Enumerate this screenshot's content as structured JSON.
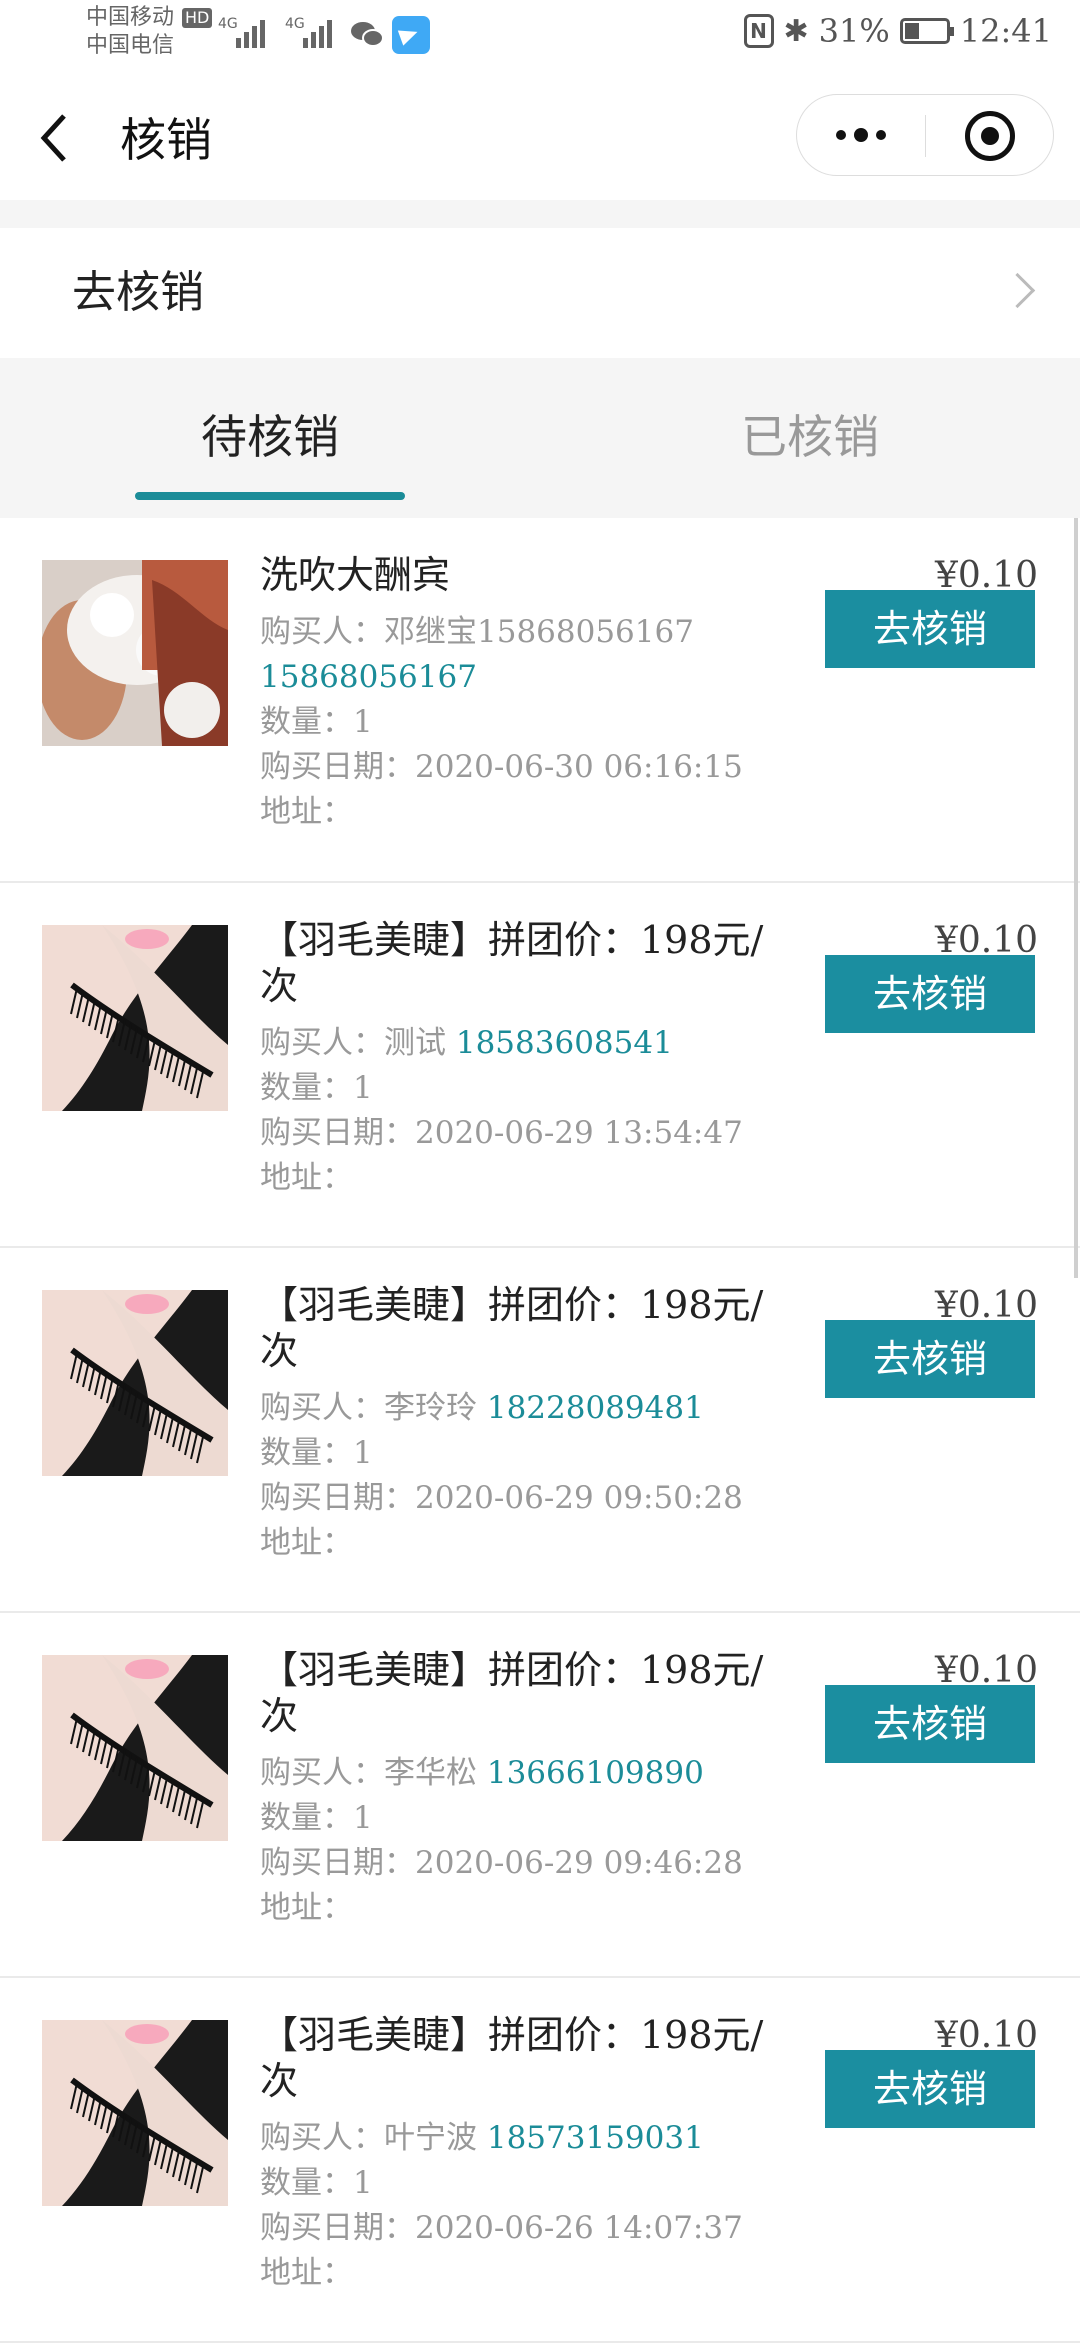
{
  "status_bar": {
    "carrier1": "中国移动",
    "carrier1_badge": "HD",
    "carrier2": "中国电信",
    "sig1": "4G",
    "sig2": "4G",
    "nfc": "N",
    "battery": "31%",
    "time": "12:41"
  },
  "nav": {
    "title": "核销"
  },
  "goto": {
    "label": "去核销"
  },
  "tabs": {
    "pending": "待核销",
    "done": "已核销",
    "active": "pending"
  },
  "labels": {
    "buyer": "购买人：",
    "qty": "数量：",
    "date": "购买日期：",
    "address": "地址：",
    "verify_button": "去核销"
  },
  "orders": [
    {
      "title": "洗吹大酬宾",
      "price": "¥0.10",
      "buyer": "邓继宝15868056167",
      "phone": "15868056167",
      "qty": "1",
      "date": "2020-06-30 06:16:15",
      "address": "",
      "image": "hair-wash"
    },
    {
      "title": "【羽毛美睫】拼团价：198元/次",
      "price": "¥0.10",
      "buyer": "测试",
      "phone": "18583608541",
      "qty": "1",
      "date": "2020-06-29 13:54:47",
      "address": "",
      "image": "eyelash"
    },
    {
      "title": "【羽毛美睫】拼团价：198元/次",
      "price": "¥0.10",
      "buyer": "李玲玲",
      "phone": "18228089481",
      "qty": "1",
      "date": "2020-06-29 09:50:28",
      "address": "",
      "image": "eyelash"
    },
    {
      "title": "【羽毛美睫】拼团价：198元/次",
      "price": "¥0.10",
      "buyer": "李华松",
      "phone": "13666109890",
      "qty": "1",
      "date": "2020-06-29 09:46:28",
      "address": "",
      "image": "eyelash"
    },
    {
      "title": "【羽毛美睫】拼团价：198元/次",
      "price": "¥0.10",
      "buyer": "叶宁波",
      "phone": "18573159031",
      "qty": "1",
      "date": "2020-06-26 14:07:37",
      "address": "",
      "image": "eyelash"
    }
  ],
  "colors": {
    "accent": "#1b8ea0",
    "link": "#1b8c98"
  }
}
